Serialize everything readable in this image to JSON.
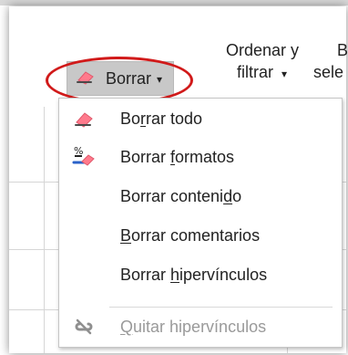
{
  "ribbon": {
    "borrar_label": "Borrar",
    "ordenar_line1": "Ordenar y",
    "ordenar_line2": "filtrar",
    "ordenar_caret": "▾",
    "partial_right_1": "B",
    "partial_right_2": "sele"
  },
  "menu": {
    "items": [
      {
        "text_before": "Bo",
        "underline": "r",
        "text_after": "rar todo",
        "icon": "eraser-icon",
        "disabled": false
      },
      {
        "text_before": "Borrar ",
        "underline": "f",
        "text_after": "ormatos",
        "icon": "clear-formats-icon",
        "disabled": false
      },
      {
        "text_before": "Borrar conteni",
        "underline": "d",
        "text_after": "o",
        "icon": "",
        "disabled": false
      },
      {
        "text_before": "",
        "underline": "B",
        "text_after": "orrar comentarios",
        "icon": "",
        "disabled": false
      },
      {
        "text_before": "Borrar ",
        "underline": "h",
        "text_after": "ipervínculos",
        "icon": "",
        "disabled": false
      },
      {
        "text_before": "",
        "underline": "Q",
        "text_after": "uitar hipervínculos",
        "icon": "remove-hyperlink-icon",
        "disabled": true
      }
    ]
  },
  "colors": {
    "highlight_oval": "#d11a1a",
    "eraser_pink": "#ff7a8c",
    "blue_accent": "#2a62c9",
    "disabled_gray": "#9a9a9a"
  }
}
